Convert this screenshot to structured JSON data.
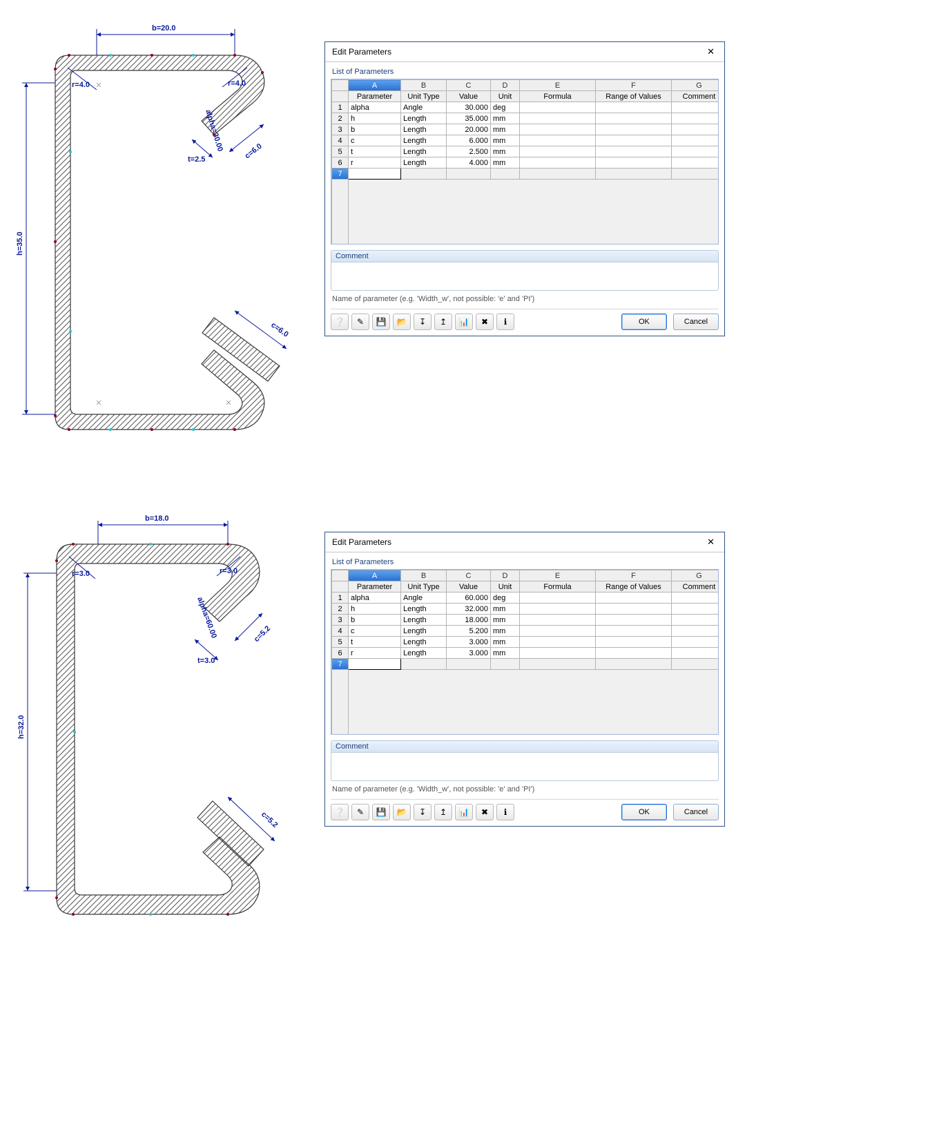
{
  "dialogs": [
    {
      "title": "Edit Parameters",
      "list_label": "List of Parameters",
      "columns_letters": [
        "A",
        "B",
        "C",
        "D",
        "E",
        "F",
        "G"
      ],
      "columns": [
        "Parameter",
        "Unit Type",
        "Value",
        "Unit",
        "Formula",
        "Range of Values",
        "Comment"
      ],
      "rows": [
        {
          "n": "1",
          "param": "alpha",
          "utype": "Angle",
          "value": "30.000",
          "unit": "deg"
        },
        {
          "n": "2",
          "param": "h",
          "utype": "Length",
          "value": "35.000",
          "unit": "mm"
        },
        {
          "n": "3",
          "param": "b",
          "utype": "Length",
          "value": "20.000",
          "unit": "mm"
        },
        {
          "n": "4",
          "param": "c",
          "utype": "Length",
          "value": "6.000",
          "unit": "mm"
        },
        {
          "n": "5",
          "param": "t",
          "utype": "Length",
          "value": "2.500",
          "unit": "mm"
        },
        {
          "n": "6",
          "param": "r",
          "utype": "Length",
          "value": "4.000",
          "unit": "mm"
        }
      ],
      "active_row": "7",
      "comment_label": "Comment",
      "hint": "Name of parameter (e.g. 'Width_w', not possible: 'e' and 'PI')",
      "ok": "OK",
      "cancel": "Cancel"
    },
    {
      "title": "Edit Parameters",
      "list_label": "List of Parameters",
      "columns_letters": [
        "A",
        "B",
        "C",
        "D",
        "E",
        "F",
        "G"
      ],
      "columns": [
        "Parameter",
        "Unit Type",
        "Value",
        "Unit",
        "Formula",
        "Range of Values",
        "Comment"
      ],
      "rows": [
        {
          "n": "1",
          "param": "alpha",
          "utype": "Angle",
          "value": "60.000",
          "unit": "deg"
        },
        {
          "n": "2",
          "param": "h",
          "utype": "Length",
          "value": "32.000",
          "unit": "mm"
        },
        {
          "n": "3",
          "param": "b",
          "utype": "Length",
          "value": "18.000",
          "unit": "mm"
        },
        {
          "n": "4",
          "param": "c",
          "utype": "Length",
          "value": "5.200",
          "unit": "mm"
        },
        {
          "n": "5",
          "param": "t",
          "utype": "Length",
          "value": "3.000",
          "unit": "mm"
        },
        {
          "n": "6",
          "param": "r",
          "utype": "Length",
          "value": "3.000",
          "unit": "mm"
        }
      ],
      "active_row": "7",
      "comment_label": "Comment",
      "hint": "Name of parameter (e.g. 'Width_w', not possible: 'e' and 'PI')",
      "ok": "OK",
      "cancel": "Cancel"
    }
  ],
  "sketches": [
    {
      "dims": {
        "b": "b=20.0",
        "h": "h=35.0",
        "r1": "r=4.0",
        "r2": "r=4.0",
        "alpha": "alpha=30.00",
        "t": "t=2.5",
        "c1": "c=6.0",
        "c2": "c=6.0"
      }
    },
    {
      "dims": {
        "b": "b=18.0",
        "h": "h=32.0",
        "r1": "r=3.0",
        "r2": "r=3.0",
        "alpha": "alpha=60.00",
        "t": "t=3.0",
        "c1": "c=5.2",
        "c2": "c=5.2"
      }
    }
  ],
  "toolbar_icons": [
    "❔",
    "✎",
    "💾",
    "📂",
    "↧",
    "↥",
    "📊",
    "✖",
    "ℹ"
  ]
}
